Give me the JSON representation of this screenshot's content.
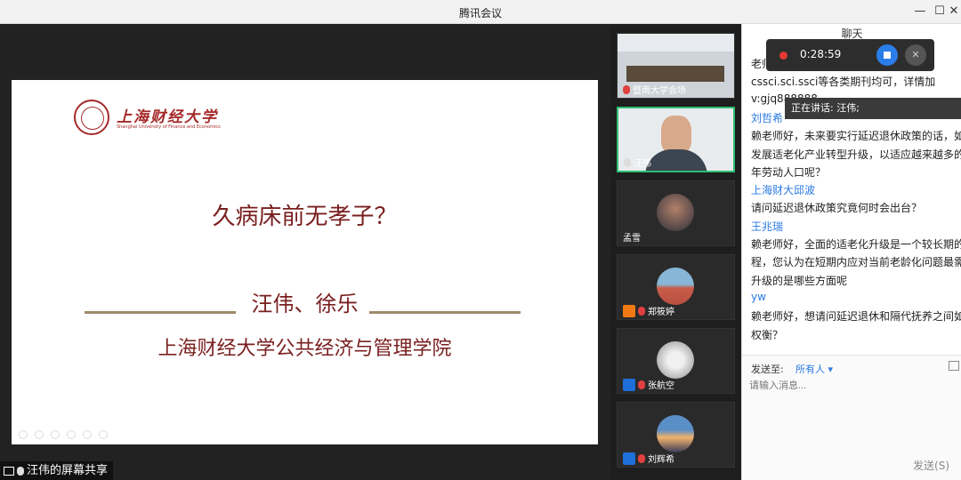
{
  "window": {
    "title": "腾讯会议",
    "minimize_icon": "minimize-icon",
    "maximize_icon": "maximize-icon",
    "close_icon": "close-icon"
  },
  "slide": {
    "logo_text": "上海财经大学",
    "logo_english": "Shanghai University of Finance and Economics",
    "title": "久病床前无孝子？",
    "authors": "汪伟、徐乐",
    "school": "上海财经大学公共经济与管理学院"
  },
  "share_label": "汪伟的屏幕共享",
  "participants": [
    {
      "name": "暨南大学会场",
      "kind": "video"
    },
    {
      "name": "汪伟",
      "kind": "video",
      "speaking": true
    },
    {
      "name": "孟雪",
      "kind": "avatar"
    },
    {
      "name": "郑筱婷",
      "kind": "avatar"
    },
    {
      "name": "张航空",
      "kind": "avatar"
    },
    {
      "name": "刘辉希",
      "kind": "avatar"
    }
  ],
  "chat": {
    "header": "聊天",
    "lines": [
      {
        "text": "老师",
        "style": "normal"
      },
      {
        "text": "cssci.sci.ssci等各类期刊均可，详情加",
        "style": "normal"
      },
      {
        "text": "v:gjq888888",
        "style": "normal"
      },
      {
        "text": "刘哲希",
        "style": "blue"
      },
      {
        "text": "赖老师好，未来要实行延迟退休政策的话，如何",
        "style": "normal"
      },
      {
        "text": "发展适老化产业转型升级，以适应越来越多的老",
        "style": "normal"
      },
      {
        "text": "年劳动人口呢？",
        "style": "normal"
      },
      {
        "text": "上海财大邱波",
        "style": "blue"
      },
      {
        "text": "请问延迟退休政策究竟何时会出台？",
        "style": "normal"
      },
      {
        "text": "王兆瑞",
        "style": "blue"
      },
      {
        "text": "赖老师好，全面的适老化升级是一个较长期的过",
        "style": "normal"
      },
      {
        "text": "程，您认为在短期内应对当前老龄化问题最需要",
        "style": "normal"
      },
      {
        "text": "升级的是哪些方面呢",
        "style": "normal"
      },
      {
        "text": "yw",
        "style": "blue"
      },
      {
        "text": "赖老师好，想请问延迟退休和隔代抚养之间如何",
        "style": "normal"
      },
      {
        "text": "权衡？",
        "style": "normal"
      }
    ],
    "send_to_label": "发送至:",
    "send_to_value": "所有人 ▾",
    "input_placeholder": "请输入消息...",
    "send_button": "发送(S)"
  },
  "recording": {
    "time": "0:28:59"
  },
  "speaking_indicator": "正在讲话: 汪伟;"
}
